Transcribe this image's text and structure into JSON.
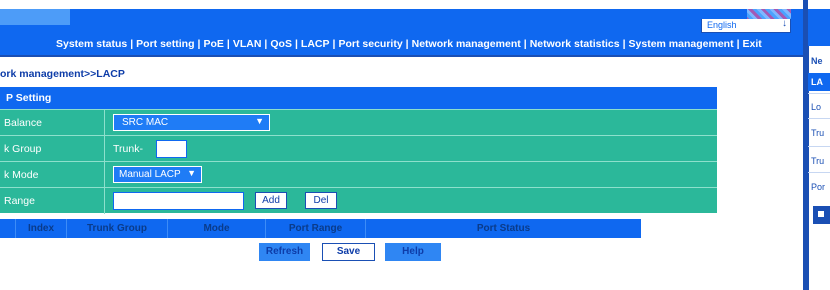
{
  "header": {
    "language": "English",
    "nav": [
      "System status",
      "Port setting",
      "PoE",
      "VLAN",
      "QoS",
      "LACP",
      "Port security",
      "Network management",
      "Network statistics",
      "System management",
      "Exit"
    ],
    "nav_separator": "|"
  },
  "breadcrumb": "ork management>>LACP",
  "panel": {
    "title": "P Setting"
  },
  "form": {
    "load_balance": {
      "label": "Balance",
      "value": "SRC MAC"
    },
    "trunk_group": {
      "label": "k Group",
      "prefix": "Trunk-",
      "value": ""
    },
    "trunk_mode": {
      "label": "k Mode",
      "value": "Manual LACP"
    },
    "port_range": {
      "label": "Range",
      "value": "",
      "add_label": "Add",
      "del_label": "Del"
    }
  },
  "table": {
    "columns": [
      "Index",
      "Trunk Group",
      "Mode",
      "Port Range",
      "Port Status"
    ]
  },
  "actions": {
    "refresh": "Refresh",
    "save": "Save",
    "help": "Help"
  },
  "side_menu": {
    "items": [
      "Ne",
      "LA",
      "Lo",
      "Tru",
      "Tru",
      "Por"
    ]
  },
  "colors": {
    "accent": "#0f68f0",
    "form_bg": "#2bb89a",
    "nav_text": "#ffffff"
  }
}
